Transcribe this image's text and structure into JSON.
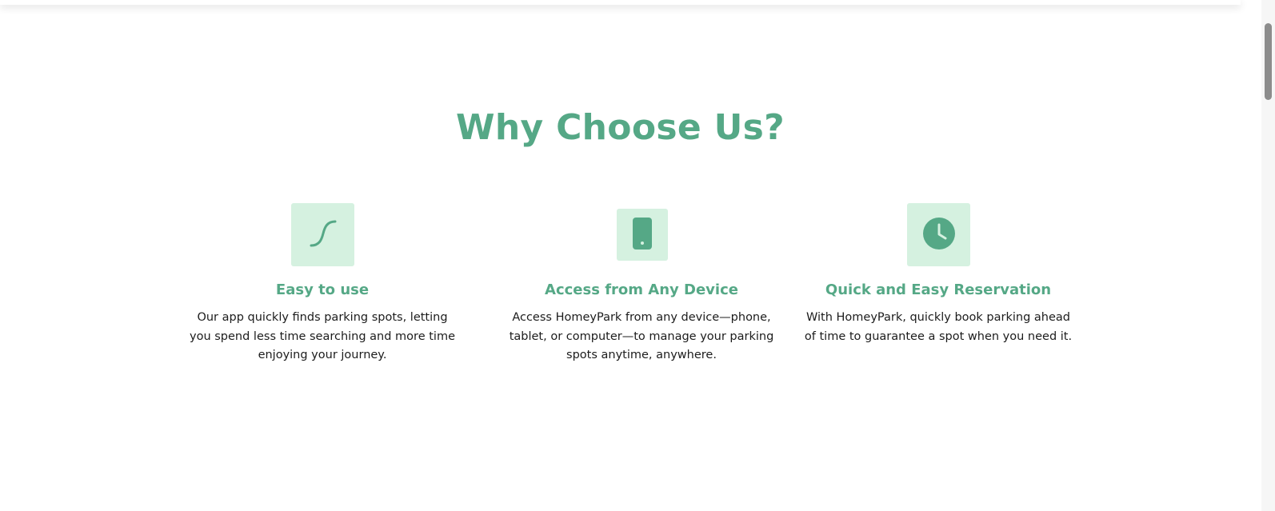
{
  "section": {
    "title": "Why Choose Us?"
  },
  "features": [
    {
      "icon": "curve-icon",
      "title": "Easy to use",
      "description": "Our app quickly finds parking spots, letting you spend less time searching and more time enjoying your journey."
    },
    {
      "icon": "mobile-phone-icon",
      "title": "Access from Any Device",
      "description": "Access HomeyPark from any device—phone, tablet, or computer—to manage your parking spots anytime, anywhere."
    },
    {
      "icon": "clock-icon",
      "title": "Quick and Easy Reservation",
      "description": "With HomeyPark, quickly book parking ahead of time to guarantee a spot when you need it."
    }
  ],
  "colors": {
    "accent": "#55a886",
    "icon_background": "#d5f1e0",
    "body_text": "#1c1c1c",
    "background": "#ffffff"
  }
}
